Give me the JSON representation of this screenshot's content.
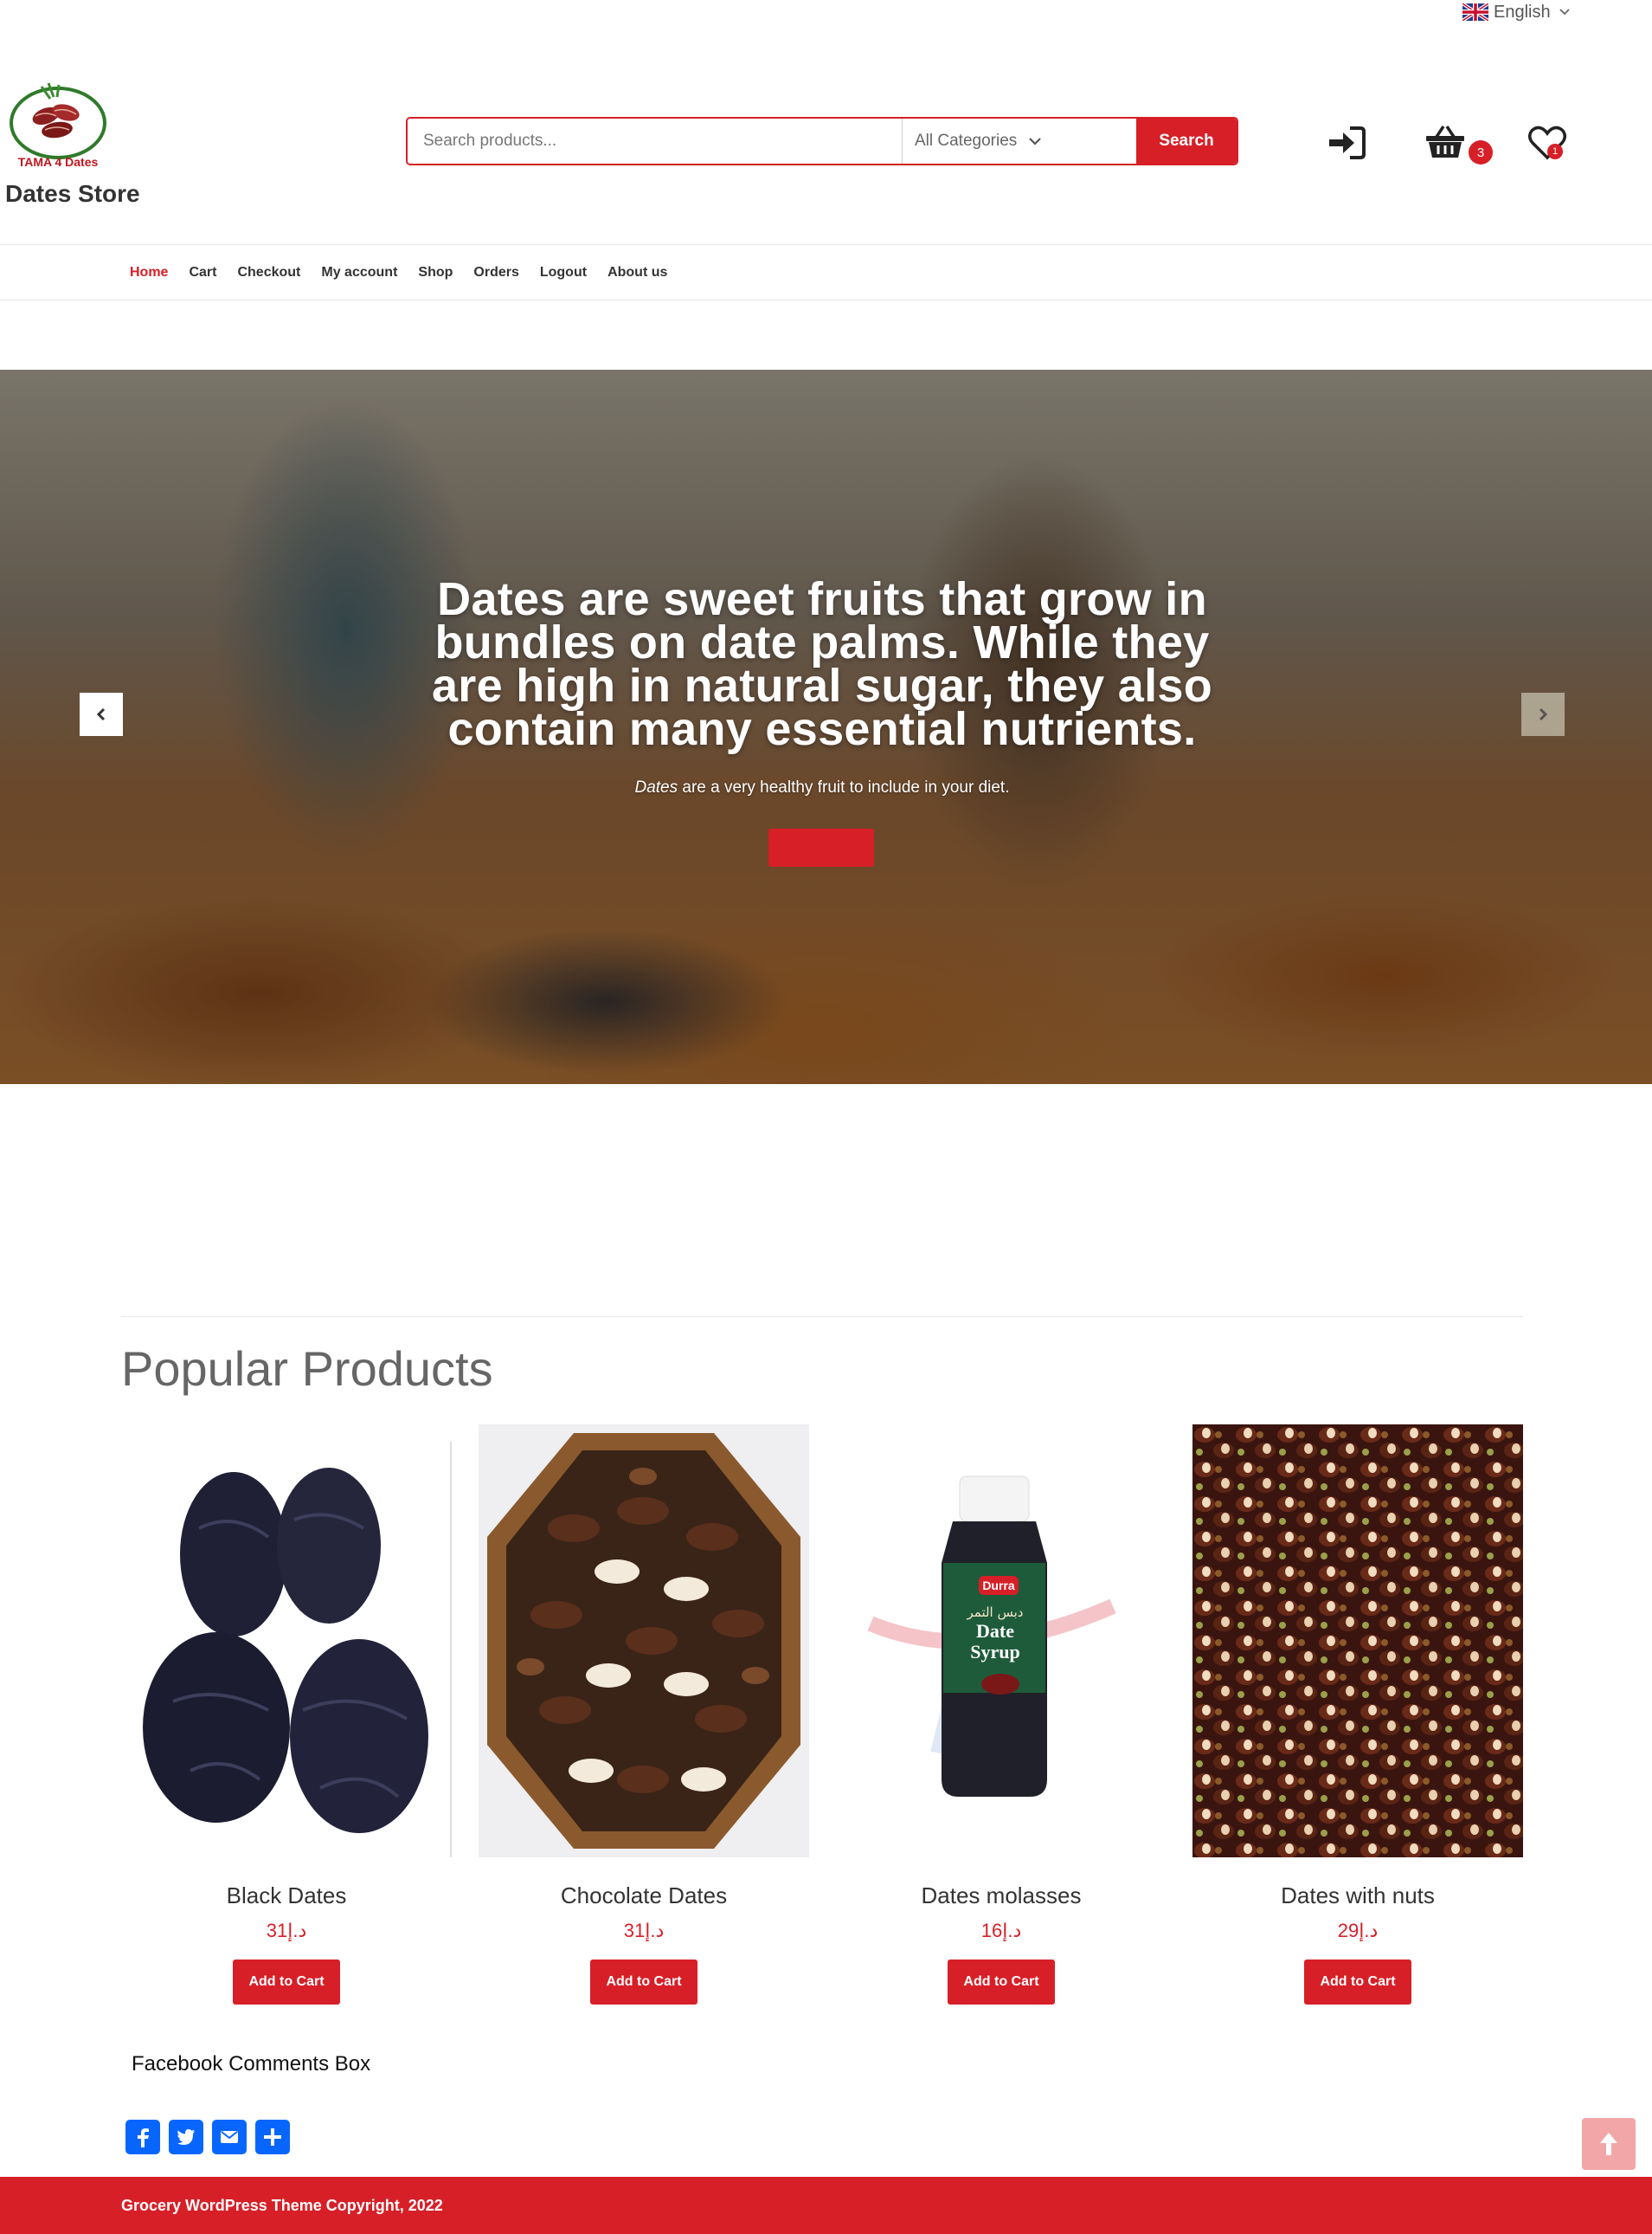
{
  "colors": {
    "accent": "#d71f27",
    "footer": "#d71f27",
    "share": "#0866ff"
  },
  "language": {
    "label": "English",
    "flag_icon": "uk-flag-icon"
  },
  "header": {
    "brand": "Dates Store",
    "logo_text": "TAMA 4 Dates",
    "search": {
      "placeholder": "Search products...",
      "category": "All Categories",
      "button": "Search"
    },
    "cart_count": "3",
    "wishlist_count": "1"
  },
  "nav": {
    "items": [
      {
        "label": "Home",
        "active": true
      },
      {
        "label": "Cart"
      },
      {
        "label": "Checkout"
      },
      {
        "label": "My account"
      },
      {
        "label": "Shop"
      },
      {
        "label": "Orders"
      },
      {
        "label": "Logout"
      },
      {
        "label": "About us"
      }
    ]
  },
  "hero": {
    "headline": "Dates are sweet fruits that grow in bundles on date palms. While they are high in natural sugar, they also contain many essential nutrients.",
    "sub_em": "Dates",
    "sub_rest": " are a very healthy fruit to include in your diet."
  },
  "products": {
    "title": "Popular Products",
    "items": [
      {
        "name": "Black Dates",
        "price": "31د.إ",
        "button": "Add to Cart"
      },
      {
        "name": "Chocolate Dates",
        "price": "31د.إ",
        "button": "Add to Cart"
      },
      {
        "name": "Dates molasses",
        "price": "16د.إ",
        "button": "Add to Cart"
      },
      {
        "name": "Dates with nuts",
        "price": "29د.إ",
        "button": "Add to Cart"
      }
    ],
    "syrup_label": {
      "brand": "Durra",
      "arabic": "دبس التمر",
      "line1": "Date",
      "line2": "Syrup"
    }
  },
  "facebook": {
    "title": "Facebook Comments Box"
  },
  "footer": {
    "copyright": "Grocery WordPress Theme Copyright, 2022"
  }
}
